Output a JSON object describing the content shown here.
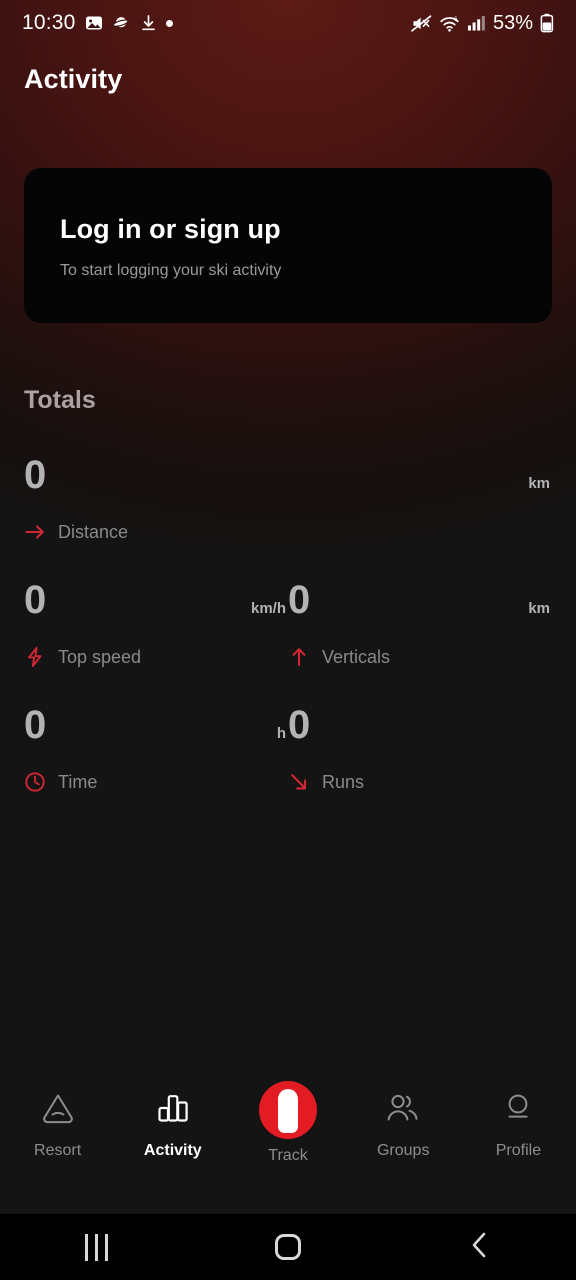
{
  "status_bar": {
    "time": "10:30",
    "battery_percent": "53%",
    "left_icons": [
      "image-icon",
      "saturn-icon",
      "download-icon",
      "dot-icon"
    ],
    "right_icons": [
      "mute-icon",
      "wifi-icon",
      "cellular-signal-icon",
      "battery-icon"
    ]
  },
  "header": {
    "title": "Activity"
  },
  "login_card": {
    "title": "Log in or sign up",
    "subtitle": "To start logging your ski activity"
  },
  "totals": {
    "heading": "Totals",
    "stats": [
      {
        "value": "0",
        "unit": "km",
        "label": "Distance",
        "icon": "arrow-right-icon",
        "span": "full"
      },
      {
        "value": "0",
        "unit": "km/h",
        "label": "Top speed",
        "icon": "lightning-bolt-icon",
        "span": "half"
      },
      {
        "value": "0",
        "unit": "km",
        "label": "Verticals",
        "icon": "arrow-up-icon",
        "span": "half"
      },
      {
        "value": "0",
        "unit": "h",
        "label": "Time",
        "icon": "clock-icon",
        "span": "half"
      },
      {
        "value": "0",
        "unit": "",
        "label": "Runs",
        "icon": "arrow-down-right-icon",
        "span": "half"
      }
    ]
  },
  "bottom_nav": {
    "items": [
      {
        "label": "Resort",
        "icon": "mountain-icon",
        "active": false
      },
      {
        "label": "Activity",
        "icon": "bar-chart-icon",
        "active": true
      },
      {
        "label": "Track",
        "icon": "track-icon",
        "active": false
      },
      {
        "label": "Groups",
        "icon": "people-icon",
        "active": false
      },
      {
        "label": "Profile",
        "icon": "person-icon",
        "active": false
      }
    ]
  },
  "system_nav": {
    "recents": "recents-icon",
    "home": "home-icon",
    "back": "back-icon"
  },
  "colors": {
    "accent_red": "#e31b23",
    "icon_red": "#d12633",
    "background_top": "#4a1512",
    "background_bottom": "#141414",
    "card_background": "#050505",
    "value_gray": "#b3b3b3",
    "label_gray": "#8a8a8a"
  }
}
